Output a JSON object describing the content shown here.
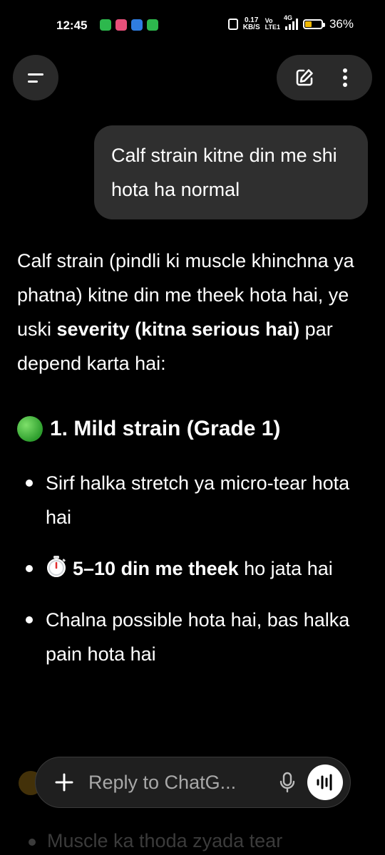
{
  "status_bar": {
    "time": "12:45",
    "net_speed_value": "0.17",
    "net_speed_unit": "KB/S",
    "volte_top": "Vo",
    "volte_bottom": "LTE1",
    "network": "4G",
    "battery_percent": "36%",
    "battery_level": 0.36,
    "app_icons": [
      {
        "name": "phone-clone-icon",
        "color": "#2db84d"
      },
      {
        "name": "photos-icon",
        "color": "#e8507a"
      },
      {
        "name": "safari-icon",
        "color": "#2f7de1"
      },
      {
        "name": "wechat-icon",
        "color": "#2db84d"
      }
    ]
  },
  "header": {
    "menu_icon": "hamburger-icon",
    "edit_icon": "edit-icon",
    "more_icon": "kebab-icon"
  },
  "conversation": {
    "user_message": "Calf strain kitne din me shi hota ha normal",
    "assistant": {
      "intro_1": "Calf strain (pindli ki muscle khinchna ya phatna) kitne din me theek hota hai, ye uski ",
      "intro_bold": "severity (kitna serious hai)",
      "intro_2": " par depend karta hai:",
      "section_title": "1. Mild strain (Grade 1)",
      "section_icon": "green-circle-icon",
      "bullets": [
        {
          "text": "Sirf halka stretch ya micro-tear hota hai"
        },
        {
          "bold": "5–10 din me theek",
          "text": " ho jata hai",
          "icon": "stopwatch-icon"
        },
        {
          "text": "Chalna possible hota hai, bas halka pain hota hai"
        }
      ],
      "faded_next": "Muscle ka thoda zyada tear"
    }
  },
  "input": {
    "placeholder": "Reply to ChatG...",
    "plus_icon": "plus-icon",
    "mic_icon": "mic-icon",
    "voice_icon": "voice-mode-icon"
  }
}
